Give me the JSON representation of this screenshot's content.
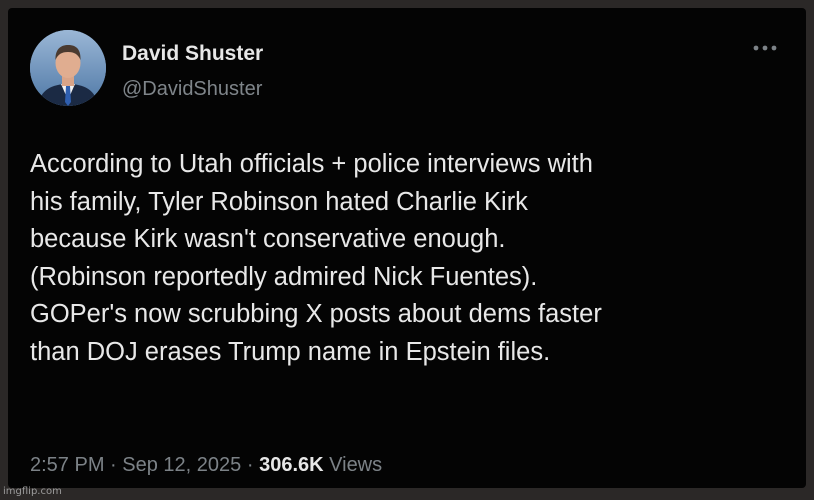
{
  "author": {
    "display_name": "David Shuster",
    "handle": "@DavidShuster",
    "avatar_icon": "profile-photo"
  },
  "more_icon": "more-horizontal-icon",
  "tweet": {
    "lines": [
      "According to Utah officials + police interviews with",
      "his family, Tyler Robinson hated Charlie Kirk",
      "because Kirk wasn't conservative enough.",
      "(Robinson reportedly admired Nick Fuentes).",
      "GOPer's now scrubbing X posts about dems faster",
      "than DOJ erases Trump name in Epstein files."
    ]
  },
  "meta": {
    "time": "2:57 PM",
    "separator": "·",
    "date": "Sep 12, 2025",
    "views_count": "306.6K",
    "views_label": "Views"
  },
  "watermark": "imgflip.com",
  "colors": {
    "background": "#040404",
    "primary_text": "#e8e8e8",
    "secondary_text": "#7c8287"
  }
}
